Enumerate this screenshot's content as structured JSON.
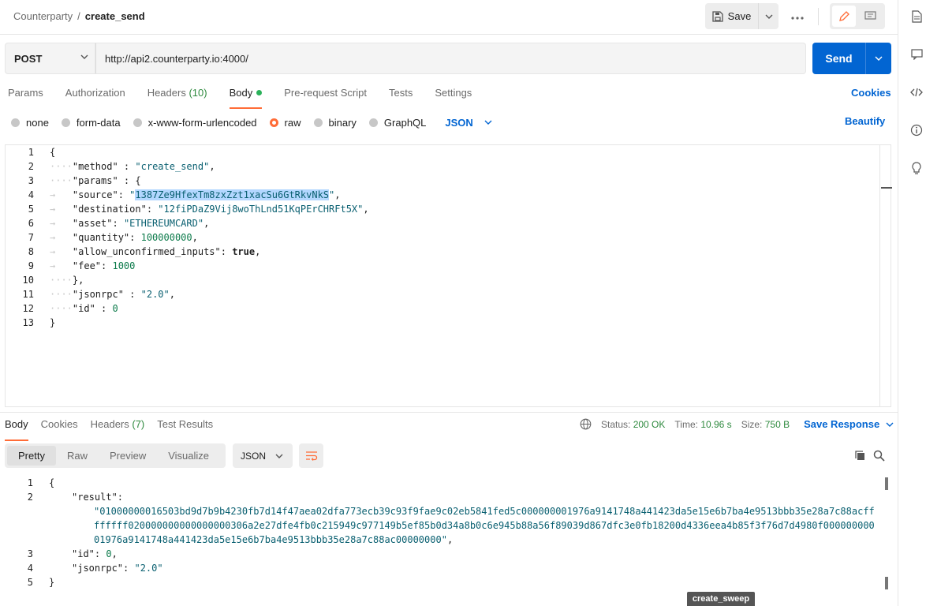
{
  "header": {
    "breadcrumb_parent": "Counterparty",
    "breadcrumb_sep": "/",
    "breadcrumb_current": "create_send",
    "save_label": "Save",
    "more_label": "ooo"
  },
  "request": {
    "method": "POST",
    "url": "http://api2.counterparty.io:4000/",
    "send_label": "Send",
    "tabs": [
      {
        "label": "Params"
      },
      {
        "label": "Authorization"
      },
      {
        "label": "Headers",
        "count": "(10)"
      },
      {
        "label": "Body"
      },
      {
        "label": "Pre-request Script"
      },
      {
        "label": "Tests"
      },
      {
        "label": "Settings"
      }
    ],
    "cookies_label": "Cookies",
    "body_types": [
      "none",
      "form-data",
      "x-www-form-urlencoded",
      "raw",
      "binary",
      "GraphQL"
    ],
    "selected_body_type": "raw",
    "format": "JSON",
    "beautify_label": "Beautify",
    "line_numbers": [
      "1",
      "2",
      "3",
      "4",
      "5",
      "6",
      "7",
      "8",
      "9",
      "10",
      "11",
      "12",
      "13"
    ],
    "code": {
      "l1": "{",
      "l2_key": "\"method\"",
      "l2_sep": " : ",
      "l2_val": "\"create_send\"",
      "l2_end": ",",
      "l3_key": "\"params\"",
      "l3_sep": " : {",
      "l4_key": "\"source\"",
      "l4_sep": ": ",
      "l4_q1": "\"",
      "l4_val": "1387Ze9HfexTm8zxZzt1xacSu6GtRkvNkS",
      "l4_q2": "\"",
      "l4_end": ",",
      "l5_key": "\"destination\"",
      "l5_sep": ": ",
      "l5_val": "\"12fiPDaZ9Vij8woThLnd51KqPErCHRFt5X\"",
      "l5_end": ",",
      "l6_key": "\"asset\"",
      "l6_sep": ": ",
      "l6_val": "\"ETHEREUMCARD\"",
      "l6_end": ",",
      "l7_key": "\"quantity\"",
      "l7_sep": ": ",
      "l7_val": "100000000",
      "l7_end": ",",
      "l8_key": "\"allow_unconfirmed_inputs\"",
      "l8_sep": ": ",
      "l8_val": "true",
      "l8_end": ",",
      "l9_key": "\"fee\"",
      "l9_sep": ": ",
      "l9_val": "1000",
      "l10": "},",
      "l11_key": "\"jsonrpc\"",
      "l11_sep": " : ",
      "l11_val": "\"2.0\"",
      "l11_end": ",",
      "l12_key": "\"id\"",
      "l12_sep": " : ",
      "l12_val": "0",
      "l13": "}"
    }
  },
  "response": {
    "tabs": [
      {
        "label": "Body"
      },
      {
        "label": "Cookies"
      },
      {
        "label": "Headers",
        "count": "(7)"
      },
      {
        "label": "Test Results"
      }
    ],
    "status_label": "Status:",
    "status_value": "200 OK",
    "time_label": "Time:",
    "time_value": "10.96 s",
    "size_label": "Size:",
    "size_value": "750 B",
    "save_response_label": "Save Response",
    "view_tabs": [
      "Pretty",
      "Raw",
      "Preview",
      "Visualize"
    ],
    "format": "JSON",
    "line_numbers": [
      "1",
      "2",
      "",
      "",
      "3",
      "4",
      "5"
    ],
    "code": {
      "l1": "{",
      "l2_key": "\"result\"",
      "l2_sep": ":",
      "result_1": "\"01000000016503bd9d7b9b4230fb7d14f47aea02dfa773ecb39c93f9fae9c02eb5841fed5c000000001976a9141748a441423da5e15e6b7ba4e9513bbb35e28a7c88acff",
      "result_2": "ffffff020000000000000000306a2e27dfe4fb0c215949c977149b5ef85b0d34a8b0c6e945b88a56f89039d867dfc3e0fb18200d4336eea4b85f3f76d7d4980f000000000",
      "result_3": "01976a9141748a441423da5e15e6b7ba4e9513bbb35e28a7c88ac00000000\"",
      "result_end": ",",
      "l3_key": "\"id\"",
      "l3_sep": ": ",
      "l3_val": "0",
      "l3_end": ",",
      "l4_key": "\"jsonrpc\"",
      "l4_sep": ": ",
      "l4_val": "\"2.0\"",
      "l5": "}"
    }
  },
  "tooltip": "create_sweep",
  "colors": {
    "accent": "#0265d2",
    "tab_indicator": "#ff6c37",
    "status_ok": "#2f8a3f"
  }
}
